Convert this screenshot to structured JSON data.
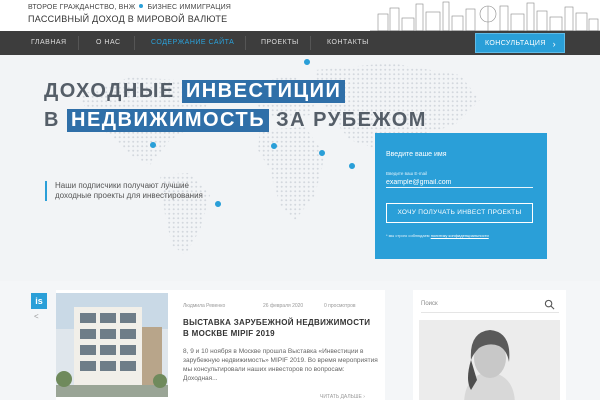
{
  "header": {
    "tag_part1": "ВТОРОЕ ГРАЖДАНСТВО, ВНЖ",
    "tag_part2": "БИЗНЕС ИММИГРАЦИЯ",
    "slogan": "ПАССИВНЫЙ ДОХОД В МИРОВОЙ ВАЛЮТЕ"
  },
  "nav": {
    "items": [
      {
        "label": "ГЛАВНАЯ"
      },
      {
        "label": "О НАС"
      },
      {
        "label": "СОДЕРЖАНИЕ САЙТА"
      },
      {
        "label": "ПРОЕКТЫ"
      },
      {
        "label": "КОНТАКТЫ"
      }
    ],
    "consult_label": "КОНСУЛЬТАЦИЯ",
    "active_color": "#2aa3dd"
  },
  "hero": {
    "line1_plain": "ДОХОДНЫЕ",
    "line1_box": "ИНВЕСТИЦИИ",
    "line2_plain_a": "В",
    "line2_box": "НЕДВИЖИМОСТЬ",
    "line2_plain_b": "ЗА РУБЕЖОМ",
    "subtext": "Наши подписчики получают лучшие доходные проекты для инвестирования",
    "accent_color": "#2a9fd8",
    "box_color": "#2f6fa8"
  },
  "form": {
    "title": "Введите ваше имя",
    "email_label": "Введите ваш E-mail",
    "email_value": "example@gmail.com",
    "button_label": "ХОЧУ ПОЛУЧАТЬ ИНВЕСТ ПРОЕКТЫ",
    "note_prefix": "* мы строго соблюдаем",
    "note_link": "политику конфиденциальности"
  },
  "post": {
    "author": "Людмила Ревенко",
    "date": "26 февраля 2020",
    "comments": "0 просмотров",
    "title": "ВЫСТАВКА ЗАРУБЕЖНОЙ НЕДВИЖИМОСТИ В МОСКВЕ MIPIF 2019",
    "excerpt": "8, 9 и 10 ноября в Москве прошла Выставка «Инвестиции в зарубежную недвижимость» MIPIF 2019. Во время мероприятия мы консультировали наших инвесторов по вопросам: Доходная...",
    "read_more": "ЧИТАТЬ ДАЛЬШЕ",
    "logo_text": "is"
  },
  "sidebar": {
    "search_placeholder": "Поиск"
  }
}
